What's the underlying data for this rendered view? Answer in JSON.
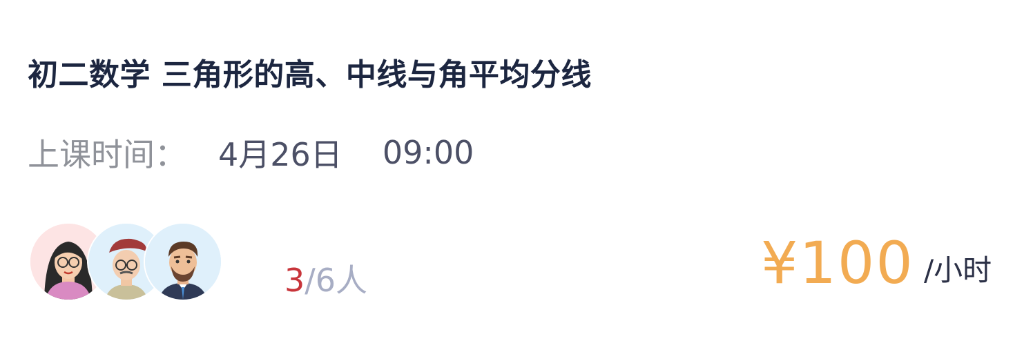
{
  "course": {
    "title": "初二数学 三角形的高、中线与角平均分线"
  },
  "schedule": {
    "label": "上课时间：",
    "date": "4月26日",
    "time": "09:00"
  },
  "enrollment": {
    "current": "3",
    "rest": "/6人"
  },
  "avatars": [
    {
      "icon": "woman-avatar-icon"
    },
    {
      "icon": "man-beret-avatar-icon"
    },
    {
      "icon": "man-suit-avatar-icon"
    }
  ],
  "pricing": {
    "price": "¥100",
    "unit": "/小时"
  },
  "colors": {
    "title": "#1c2640",
    "label": "#8f9299",
    "price": "#f2ab52",
    "count_current": "#c8343a",
    "count_rest": "#a7adc4"
  }
}
